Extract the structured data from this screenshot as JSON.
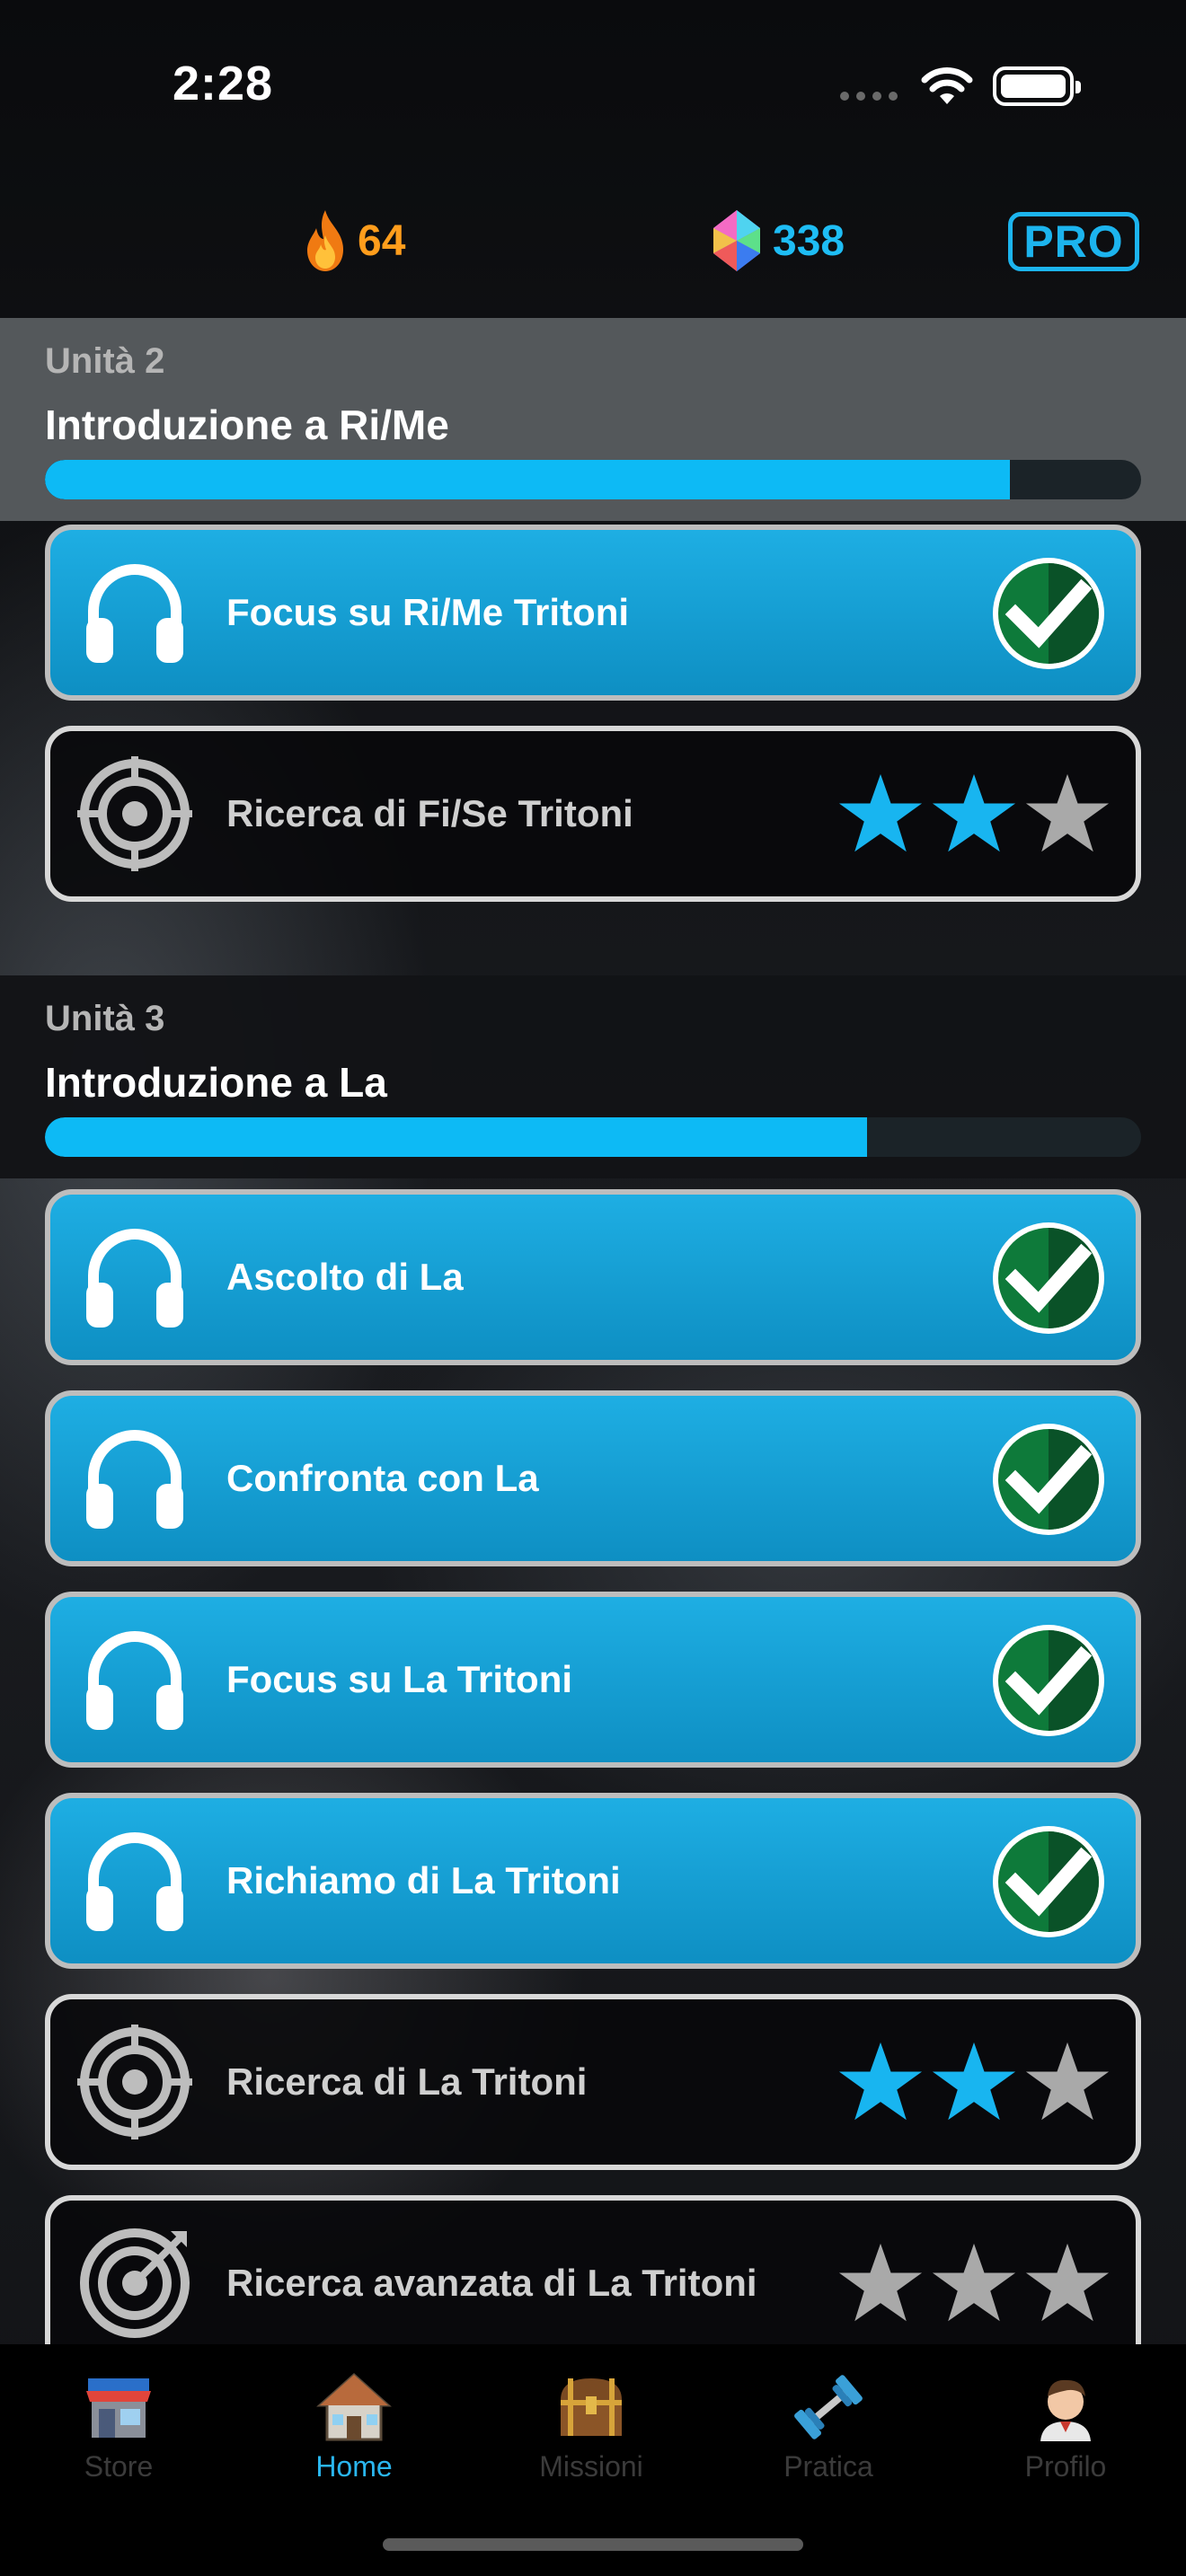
{
  "status_bar": {
    "time": "2:28"
  },
  "header": {
    "streak": {
      "value": "64",
      "icon": "flame-icon",
      "color": "#ff9d1c"
    },
    "gems": {
      "value": "338",
      "icon": "gem-icon",
      "color": "#1ebdf5"
    },
    "pro_label": "PRO"
  },
  "units": [
    {
      "label": "Unità 2",
      "title": "Introduzione a Ri/Me",
      "progress": 0.88,
      "lessons": [
        {
          "title": "Focus su Ri/Me Tritoni",
          "type": "listen",
          "completed": true
        },
        {
          "title": "Ricerca di Fi/Se Tritoni",
          "type": "target",
          "completed": false,
          "stars": 2
        }
      ]
    },
    {
      "label": "Unità 3",
      "title": "Introduzione a La",
      "progress": 0.75,
      "lessons": [
        {
          "title": "Ascolto di La",
          "type": "listen",
          "completed": true
        },
        {
          "title": "Confronta con La",
          "type": "listen",
          "completed": true
        },
        {
          "title": "Focus su La Tritoni",
          "type": "listen",
          "completed": true
        },
        {
          "title": "Richiamo di La Tritoni",
          "type": "listen",
          "completed": true
        },
        {
          "title": "Ricerca di La Tritoni",
          "type": "target",
          "completed": false,
          "stars": 2
        },
        {
          "title": "Ricerca avanzata di La Tritoni",
          "type": "target-advanced",
          "completed": false,
          "stars": 0
        }
      ]
    }
  ],
  "tabs": [
    {
      "label": "Store",
      "icon": "store-icon",
      "active": false
    },
    {
      "label": "Home",
      "icon": "home-icon",
      "active": true
    },
    {
      "label": "Missioni",
      "icon": "treasure-chest-icon",
      "active": false
    },
    {
      "label": "Pratica",
      "icon": "dumbbell-icon",
      "active": false
    },
    {
      "label": "Profilo",
      "icon": "avatar-icon",
      "active": false
    }
  ],
  "colors": {
    "accent": "#0dbaf5",
    "lesson_done": "#1eaee3",
    "star_filled": "#18b5f0",
    "star_empty": "#a9a9a9"
  }
}
